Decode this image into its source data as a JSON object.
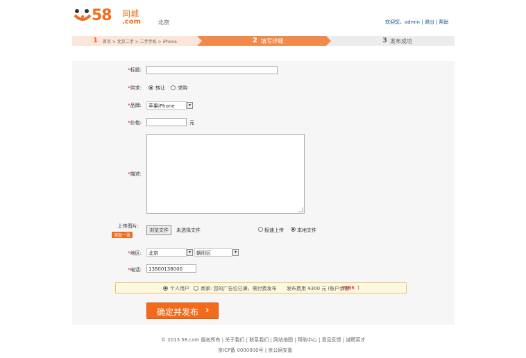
{
  "header": {
    "logo_number": "58",
    "logo_name": "同城",
    "logo_domain": ".com",
    "city": "北京",
    "top_links": "欢迎您，admin | 退出 | 帮助"
  },
  "steps": {
    "step1_num": "1",
    "step1_crumb": "首页 > 北京二手 > 二手手机 > iPhone",
    "step2_num": "2",
    "step2_label": "填写详细",
    "step3_num": "3",
    "step3_label": "发布成功"
  },
  "form": {
    "title_label": "标题:",
    "title_value": "",
    "type_label": "供求:",
    "type_options": [
      "转让",
      "求购"
    ],
    "brand_label": "品牌:",
    "brand_value": "苹果iPhone",
    "price_label": "价格:",
    "price_value": "",
    "price_unit": "元",
    "desc_label": "描述:",
    "desc_value": "",
    "upload_label": "上传图片:",
    "upload_tag": "添加一张",
    "file_button": "浏览文件",
    "file_status": "未选择文件",
    "upload_modes": [
      "极速上传",
      "本地文件"
    ],
    "area_label": "地区:",
    "area_city": "北京",
    "area_district": "朝阳区",
    "phone_label": "电话:",
    "phone_value": "13800138000"
  },
  "notice": {
    "option1": "个人用户",
    "option2": "商家: 您的广告位已满，需付费发布",
    "fee_text": "发布费用 ¥300 元 (账户余额:",
    "balance": "2166",
    "close": ")"
  },
  "submit_label": "确定并发布",
  "footer": {
    "line1": "© 2013 58.com 版权所有 | 关于我们 | 联系我们 | 网站地图 | 帮助中心 | 意见反馈 | 诚聘英才",
    "line2": "京ICP备 0000000号 | 京公网安备"
  },
  "colors": {
    "brand": "#f26b1d",
    "link": "#1a4b8e"
  }
}
